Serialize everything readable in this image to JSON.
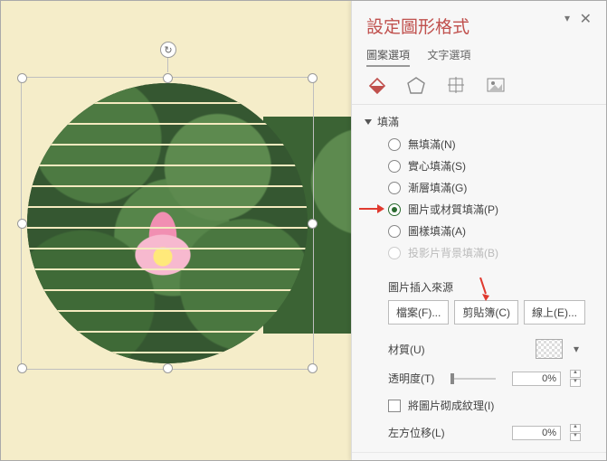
{
  "panel": {
    "title": "設定圖形格式",
    "tabs": {
      "shape_options": "圖案選項",
      "text_options": "文字選項"
    },
    "fill": {
      "header": "填滿",
      "no_fill": "無填滿(N)",
      "solid": "實心填滿(S)",
      "gradient": "漸層填滿(G)",
      "picture_texture": "圖片或材質填滿(P)",
      "pattern": "圖樣填滿(A)",
      "slide_bg": "投影片背景填滿(B)"
    },
    "insert_from": {
      "label": "圖片插入來源",
      "file": "檔案(F)...",
      "clipboard": "剪貼簿(C)",
      "online": "線上(E)..."
    },
    "texture_label": "材質(U)",
    "transparency": {
      "label": "透明度(T)",
      "value": "0%"
    },
    "tile_checkbox": "將圖片砌成紋理(I)",
    "offset_left": {
      "label": "左方位移(L)",
      "value": "0%"
    }
  },
  "icons": {
    "pin": "▾",
    "close": "✕",
    "rotate": "↻",
    "fill_icon": "fill-bucket-icon",
    "effects_icon": "pentagon-icon",
    "size_icon": "size-arrows-icon",
    "picture_icon": "picture-icon"
  },
  "colors": {
    "accent": "#c0504d",
    "selected_radio": "#2a6b2f"
  }
}
